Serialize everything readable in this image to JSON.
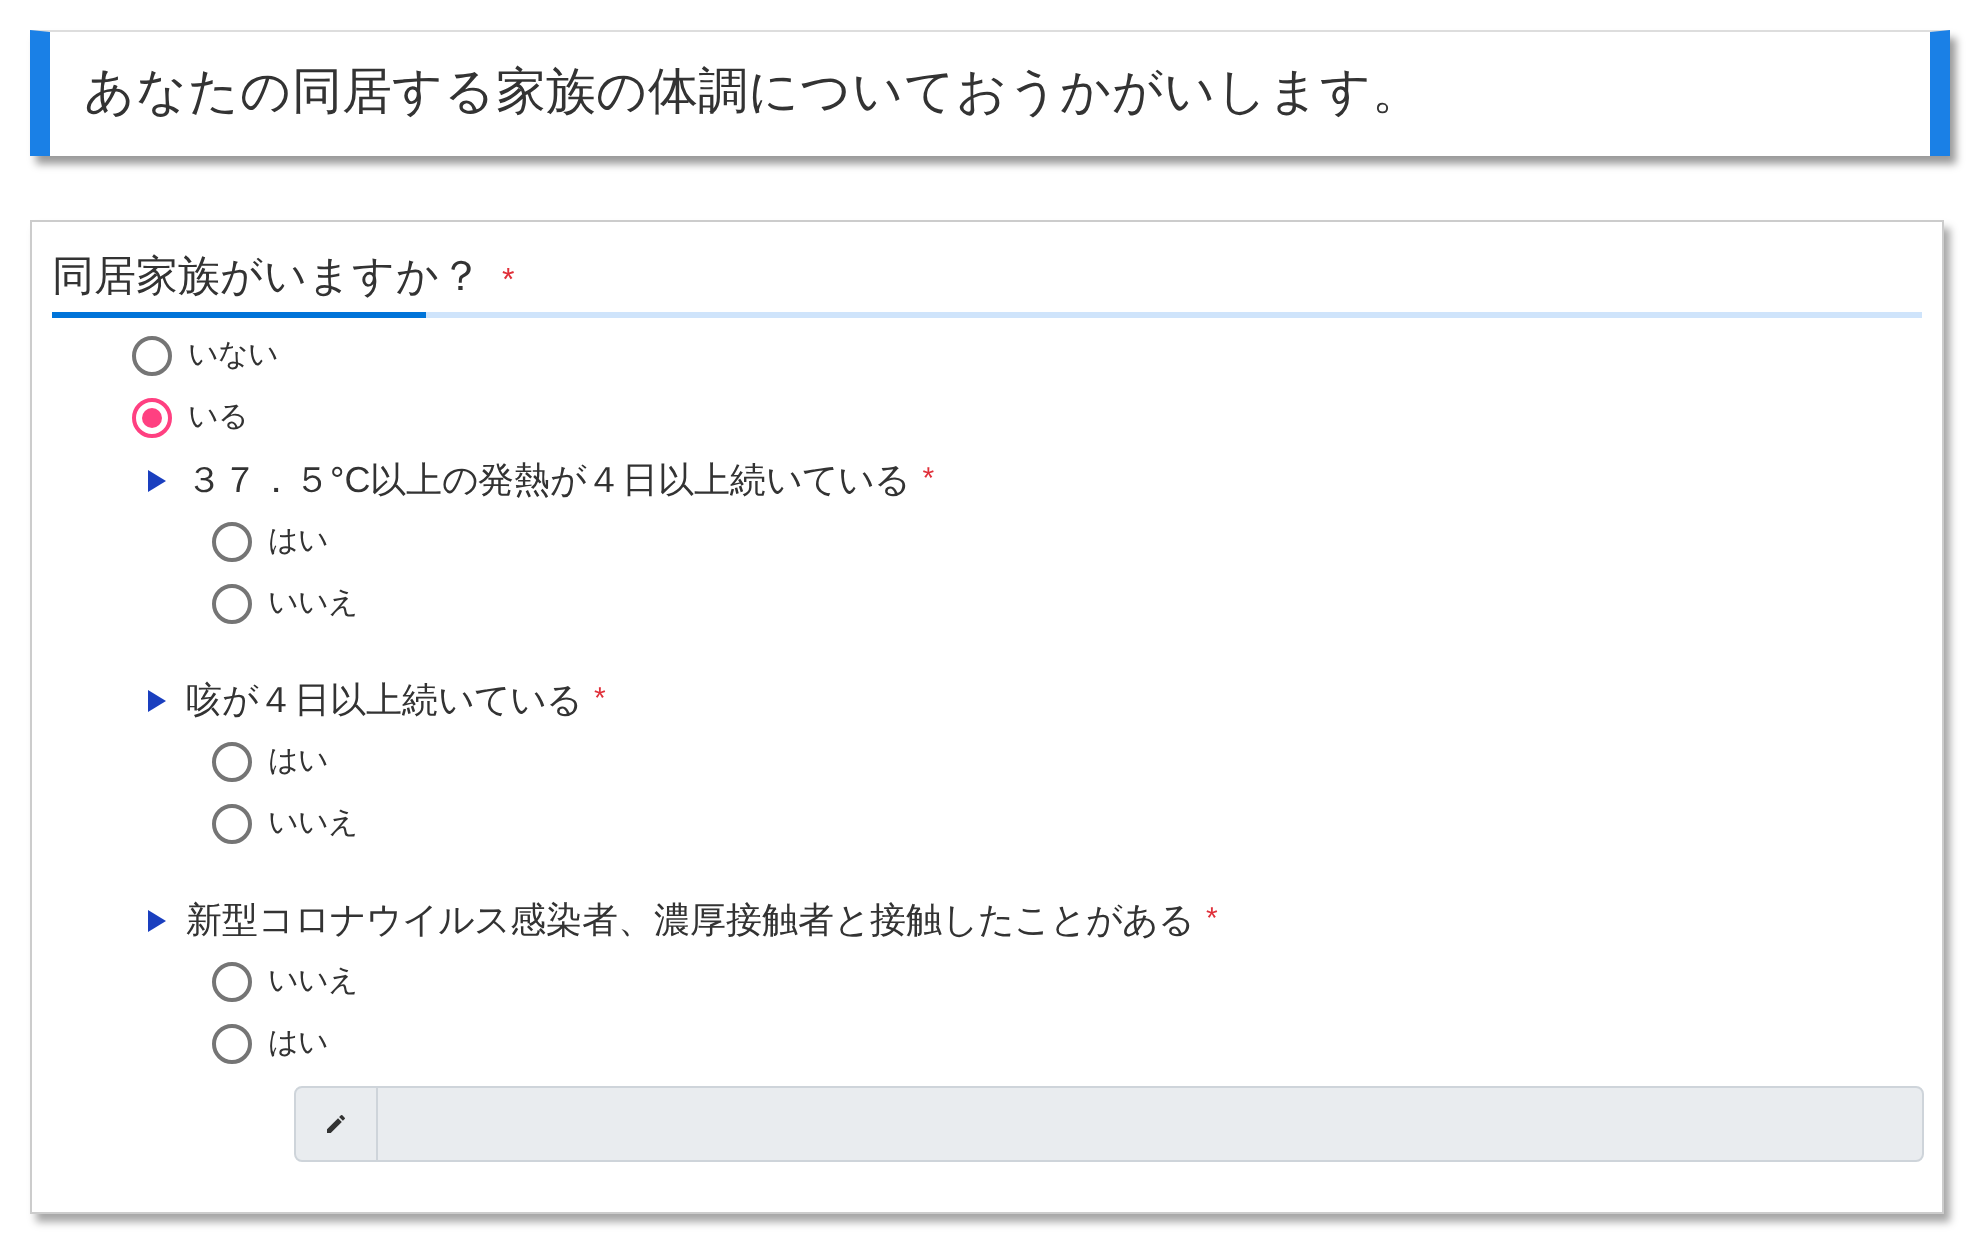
{
  "header": {
    "title": "あなたの同居する家族の体調についておうかがいします。"
  },
  "question": {
    "label": "同居家族がいますか？",
    "required_mark": "*",
    "options": [
      {
        "label": "いない",
        "selected": false
      },
      {
        "label": "いる",
        "selected": true
      }
    ],
    "sub_questions": [
      {
        "label": "３７．５°C以上の発熱が４日以上続いている",
        "required_mark": "*",
        "options": [
          {
            "label": "はい",
            "selected": false
          },
          {
            "label": "いいえ",
            "selected": false
          }
        ]
      },
      {
        "label": "咳が４日以上続いている",
        "required_mark": "*",
        "options": [
          {
            "label": "はい",
            "selected": false
          },
          {
            "label": "いいえ",
            "selected": false
          }
        ]
      },
      {
        "label": "新型コロナウイルス感染者、濃厚接触者と接触したことがある",
        "required_mark": "*",
        "options": [
          {
            "label": "いいえ",
            "selected": false
          },
          {
            "label": "はい",
            "selected": false
          }
        ],
        "field": {
          "disabled": true
        }
      }
    ]
  }
}
